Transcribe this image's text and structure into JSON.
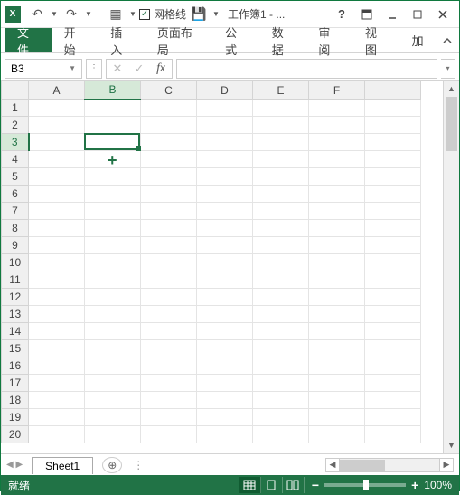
{
  "title": "工作簿1 - ...",
  "qat": {
    "gridlines_label": "网格线",
    "gridlines_checked": true
  },
  "ribbon": {
    "file": "文件",
    "tabs": [
      "开始",
      "插入",
      "页面布局",
      "公式",
      "数据",
      "审阅",
      "视图",
      "加"
    ]
  },
  "namebox": "B3",
  "formula": "",
  "columns": [
    "A",
    "B",
    "C",
    "D",
    "E",
    "F"
  ],
  "rows": [
    1,
    2,
    3,
    4,
    5,
    6,
    7,
    8,
    9,
    10,
    11,
    12,
    13,
    14,
    15,
    16,
    17,
    18,
    19,
    20
  ],
  "selected": {
    "col": "B",
    "row": 3
  },
  "sheet": {
    "name": "Sheet1"
  },
  "status": {
    "ready": "就绪",
    "zoom": "100%"
  }
}
